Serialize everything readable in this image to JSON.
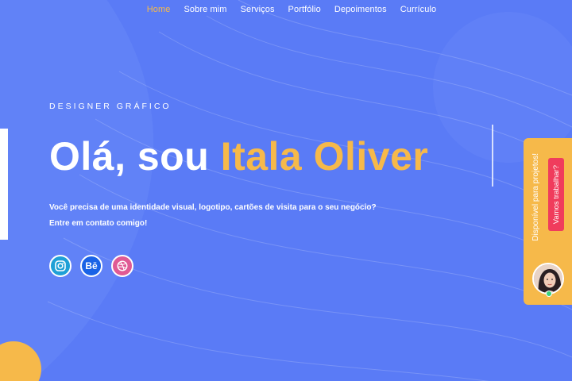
{
  "nav": {
    "items": [
      {
        "label": "Home",
        "active": true
      },
      {
        "label": "Sobre mim",
        "active": false
      },
      {
        "label": "Serviços",
        "active": false
      },
      {
        "label": "Portfólio",
        "active": false
      },
      {
        "label": "Depoimentos",
        "active": false
      },
      {
        "label": "Currículo",
        "active": false
      }
    ]
  },
  "hero": {
    "eyebrow": "DESIGNER GRÁFICO",
    "greeting": "Olá, sou",
    "name": "Itala Oliver",
    "description": "Você precisa de uma identidade visual, logotipo, cartões de visita para o seu negócio?",
    "contact": "Entre em contato comigo!"
  },
  "socials": [
    {
      "icon": "instagram-icon",
      "glyph": "◎"
    },
    {
      "icon": "behance-icon",
      "glyph": "Bē"
    },
    {
      "icon": "dribbble-icon",
      "glyph": "◍"
    }
  ],
  "side_widget": {
    "availability": "Disponível para projetos!",
    "cta_label": "Vamos trabalhar?",
    "avatar": "avatar-photo",
    "status": "online"
  },
  "colors": {
    "background": "#5a7bf6",
    "accent": "#f6b94a",
    "cta": "#f03c5c",
    "online": "#3ad07a"
  }
}
